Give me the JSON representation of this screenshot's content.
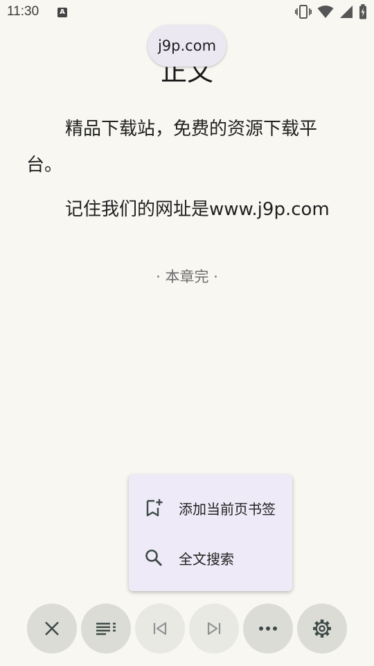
{
  "status_bar": {
    "time": "11:30",
    "notification_badge": "A",
    "icons": [
      "vibrate-icon",
      "wifi-icon",
      "signal-icon",
      "battery-charging-icon"
    ]
  },
  "reader": {
    "url_pill": "j9p.com",
    "chapter_title": "正文",
    "paragraphs": [
      "精品下载站，免费的资源下载平台。",
      "记住我们的网址是www.j9p.com"
    ],
    "chapter_end": "· 本章完 ·"
  },
  "popup_menu": {
    "items": [
      {
        "label": "添加当前页书签",
        "icon": "bookmark-add-icon"
      },
      {
        "label": "全文搜索",
        "icon": "search-icon"
      }
    ]
  },
  "bottom_bar": {
    "buttons": [
      {
        "icon": "close-icon",
        "enabled": true
      },
      {
        "icon": "table-of-contents-icon",
        "enabled": true
      },
      {
        "icon": "previous-chapter-icon",
        "enabled": false
      },
      {
        "icon": "next-chapter-icon",
        "enabled": false
      },
      {
        "icon": "more-icon",
        "enabled": true
      },
      {
        "icon": "settings-icon",
        "enabled": true
      }
    ]
  },
  "colors": {
    "background": "#f8f7f2",
    "menu_background": "#efeaf7",
    "pill_background": "#ece8f2",
    "button_background": "#dcdcd6",
    "button_disabled": "#e9e9e4",
    "icon": "#3d4a47"
  }
}
